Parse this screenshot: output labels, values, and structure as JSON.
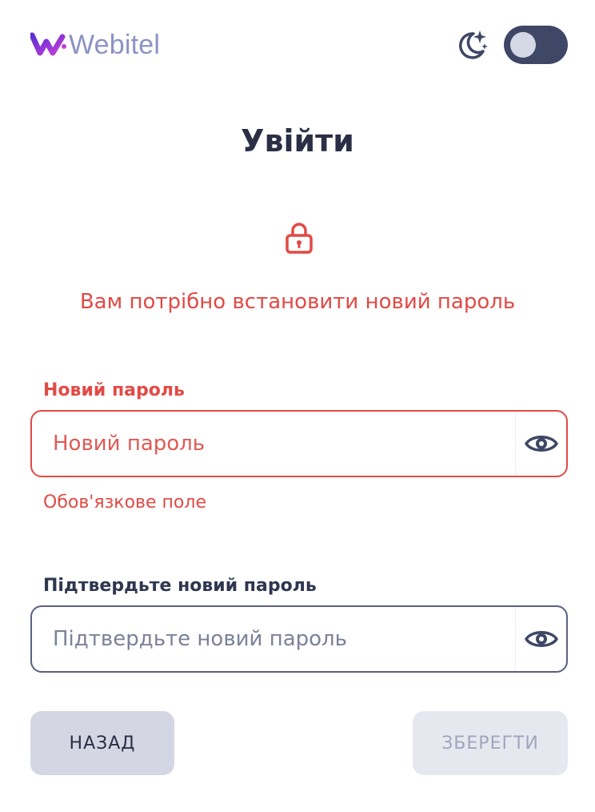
{
  "header": {
    "logo_text": "Webitel",
    "theme_icon": "moon-stars-icon",
    "dark_mode_toggle": false
  },
  "title": "Увійти",
  "lock_icon": "lock-icon",
  "notice": "Вам потрібно встановити новий пароль",
  "new_password": {
    "label": "Новий пароль",
    "placeholder": "Новий пароль",
    "value": "",
    "error": "Обов'язкове поле",
    "icon": "eye-icon"
  },
  "confirm_password": {
    "label": "Підтвердьте новий пароль",
    "placeholder": "Підтвердьте новий пароль",
    "value": "",
    "icon": "eye-icon"
  },
  "buttons": {
    "back_label": "НАЗАД",
    "save_label": "ЗБЕРЕГТИ",
    "save_disabled": true
  },
  "colors": {
    "error": "#e24a45",
    "text_dark": "#2a2f45",
    "logo_purple": "#7b3fe4",
    "logo_text": "#8c92c4",
    "toggle_track": "#3f4766"
  }
}
